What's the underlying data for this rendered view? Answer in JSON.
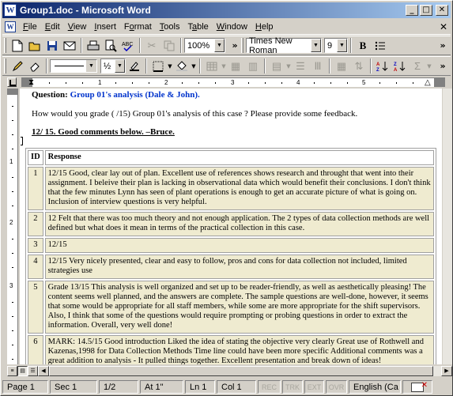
{
  "window": {
    "title": "Group1.doc - Microsoft Word",
    "app_icon": "W",
    "minimize": "_",
    "maximize": "□",
    "close": "✕"
  },
  "menu": {
    "items": [
      {
        "key": "F",
        "rest": "ile"
      },
      {
        "key": "E",
        "rest": "dit"
      },
      {
        "key": "V",
        "rest": "iew"
      },
      {
        "key": "I",
        "rest": "nsert"
      },
      {
        "key": "o",
        "pre": "F",
        "rest": "rmat"
      },
      {
        "key": "T",
        "rest": "ools"
      },
      {
        "key": "a",
        "pre": "T",
        "rest": "ble"
      },
      {
        "key": "W",
        "rest": "indow"
      },
      {
        "key": "H",
        "rest": "elp"
      }
    ],
    "doc_close": "✕"
  },
  "toolbar": {
    "zoom": "100%",
    "font": "Times New Roman",
    "size": "9",
    "bold": "B",
    "more": "»",
    "line_weight": "½"
  },
  "ruler": {
    "numbers": [
      "1",
      "2",
      "3",
      "4",
      "5"
    ]
  },
  "vruler": {
    "numbers": [
      "1",
      "2",
      "3"
    ]
  },
  "document": {
    "question_prefix": "Question: ",
    "question_title": "Group 01's analysis (Dale & John).",
    "grade_prompt": "How would you grade (  /15) Group 01's analysis of this case ? Please provide some feedback.",
    "summary": "12/ 15. Good comments below. –Bruce.",
    "table": {
      "headers": [
        "ID",
        "Response"
      ],
      "rows": [
        {
          "id": "1",
          "text": "12/15 Good, clear lay out of plan. Excellent use of references shows research and throught that went into their assignment. I beleive their plan is lacking in observational data which would benefit their conclusions. I don't think that the few minutes Lynn has seen of plant operations is enough to get an accurate picture of what is going on. Inclusion of interview questions is very helpful."
        },
        {
          "id": "2",
          "text": "12 Felt that there was too much theory and not enough application. The 2 types of data collection methods are well defined but what does it mean in terms of the practical collection in this case."
        },
        {
          "id": "3",
          "text": "12/15"
        },
        {
          "id": "4",
          "text": "12/15 Very nicely presented, clear and easy to follow, pros and cons for data collection not included, limited strategies use"
        },
        {
          "id": "5",
          "text": "Grade 13/15 This analysis is well organized and set up to be reader-friendly, as well as aesthetically pleasing! The content seems well planned, and the answers are complete. The sample questions are well-done, however, it seems that some would be appropriate for all staff members, while some are more appropriate for the shift supervisors. Also, I think that some of the questions would require prompting or probing questions in order to extract the information. Overall, very well done!"
        },
        {
          "id": "6",
          "text": "MARK: 14.5/15 Good introduction Liked the idea of stating the objective very clearly Great use of Rothwell and Kazenas,1998 for Data Collection Methods Time line could have been more specific Additional comments was a great addition to analysis - It pulled things together. Excellent presentation and break down of ideas!"
        }
      ]
    }
  },
  "status": {
    "page": "Page 1",
    "sec": "Sec 1",
    "pages": "1/2",
    "at": "At 1\"",
    "ln": "Ln 1",
    "col": "Col 1",
    "rec": "REC",
    "trk": "TRK",
    "ext": "EXT",
    "ovr": "OVR",
    "lang": "English (Ca"
  }
}
